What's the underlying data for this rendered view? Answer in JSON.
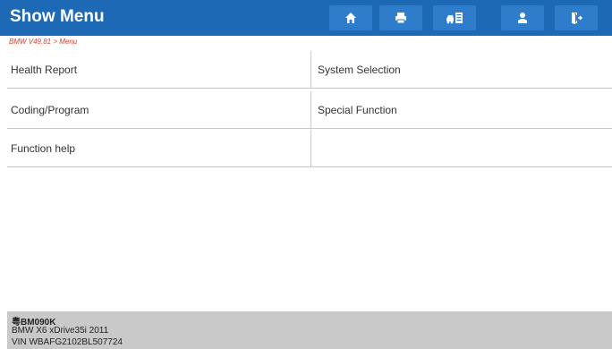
{
  "header": {
    "title": "Show Menu",
    "accent_color": "#1e69b5",
    "toolbar": [
      {
        "icon": "home-icon"
      },
      {
        "icon": "print-icon"
      },
      {
        "icon": "vehicle-info-icon"
      },
      {
        "icon": "user-icon"
      },
      {
        "icon": "exit-icon"
      }
    ]
  },
  "breadcrumb": "BMW V49.81 > Menu",
  "menu": {
    "rows": [
      {
        "left": "Health Report",
        "right": "System Selection"
      },
      {
        "left": "Coding/Program",
        "right": "Special Function"
      },
      {
        "left": "Function help",
        "right": ""
      }
    ]
  },
  "footer": {
    "plate": "粤BM090K",
    "model": "BMW X6 xDrive35i 2011",
    "vin": "VIN WBAFG2102BL507724"
  }
}
